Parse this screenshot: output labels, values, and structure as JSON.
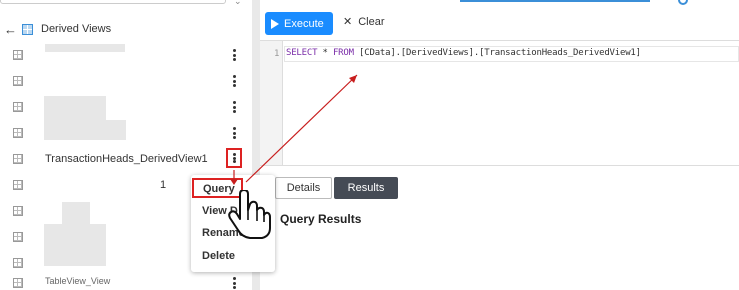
{
  "panel": {
    "title": "Derived Views",
    "rows": [
      {
        "label": ""
      },
      {
        "label": ""
      },
      {
        "label": ""
      },
      {
        "label": ""
      },
      {
        "label": "TransactionHeads_DerivedView1"
      },
      {
        "label": "1"
      },
      {
        "label": ""
      },
      {
        "label": ""
      },
      {
        "label": ""
      },
      {
        "label": "TableView_View"
      }
    ]
  },
  "toolbar": {
    "execute_label": "Execute",
    "clear_label": "Clear"
  },
  "editor": {
    "line_number": "1",
    "keyword_select": "SELECT",
    "star": " * ",
    "keyword_from": "FROM",
    "rest": " [CData].[DerivedViews].[TransactionHeads_DerivedView1]"
  },
  "results": {
    "tabs": [
      {
        "label": "Details"
      },
      {
        "label": "Results"
      }
    ],
    "title": "Query Results"
  },
  "context_menu": {
    "items": [
      {
        "label": "Query"
      },
      {
        "label": "View D"
      },
      {
        "label": "Rename"
      },
      {
        "label": "Delete"
      }
    ]
  },
  "colors": {
    "accent": "#1a8cff",
    "highlight": "#dd2222"
  }
}
